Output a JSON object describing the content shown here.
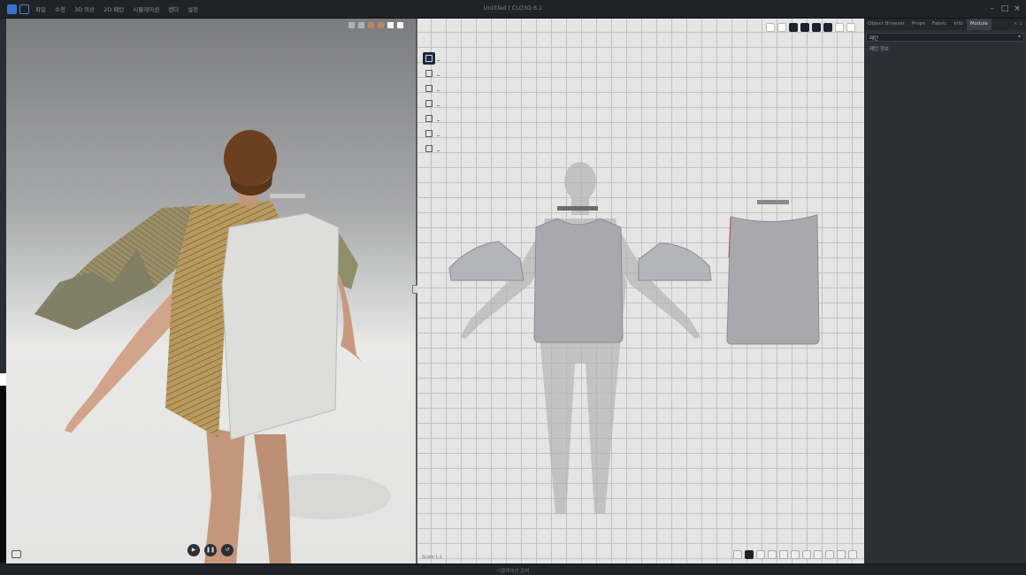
{
  "window": {
    "title": "Untitled | CLO3D 6.1",
    "menu": [
      "파일",
      "수정",
      "3D 의상",
      "2D 패턴",
      "시뮬레이션",
      "렌더",
      "설정"
    ]
  },
  "viewport3d": {
    "controls": [
      "play",
      "pause",
      "reset"
    ]
  },
  "pattern2d": {
    "scale_label": "Scale 1:1"
  },
  "properties": {
    "tabs": [
      "Object Browser",
      "Props",
      "Fabric",
      "Info",
      "Module"
    ],
    "active_tab_index": 4,
    "dropdown_value": "패턴",
    "item_label": "패턴 정보"
  },
  "statusbar": {
    "text": "시뮬레이션 준비"
  },
  "colors": {
    "accent": "#3b6fd6",
    "panel": "#2b2f36",
    "grid_bg": "#e5e5e5"
  }
}
